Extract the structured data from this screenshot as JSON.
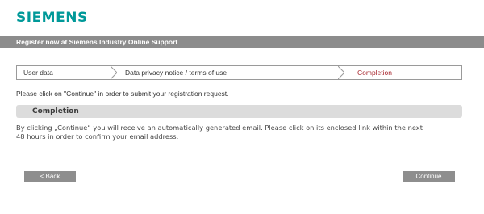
{
  "logo": {
    "text": "SIEMENS",
    "color": "#009999"
  },
  "header": {
    "title": "Register now at  Siemens Industry Online Support"
  },
  "steps": [
    {
      "label": "User data",
      "state": "done"
    },
    {
      "label": "Data privacy notice / terms of use",
      "state": "done"
    },
    {
      "label": "Completion",
      "state": "active",
      "color": "#a8282f"
    }
  ],
  "instruction": "Please click on \"Continue\" in order to submit your registration request.",
  "section": {
    "title": "Completion",
    "message_line1": "By clicking „Continue“ you will receive an automatically generated email. Please click on its enclosed link within the next",
    "message_line2": "48 hours in order to confirm your email address."
  },
  "buttons": {
    "back": "< Back",
    "continue": "Continue"
  }
}
